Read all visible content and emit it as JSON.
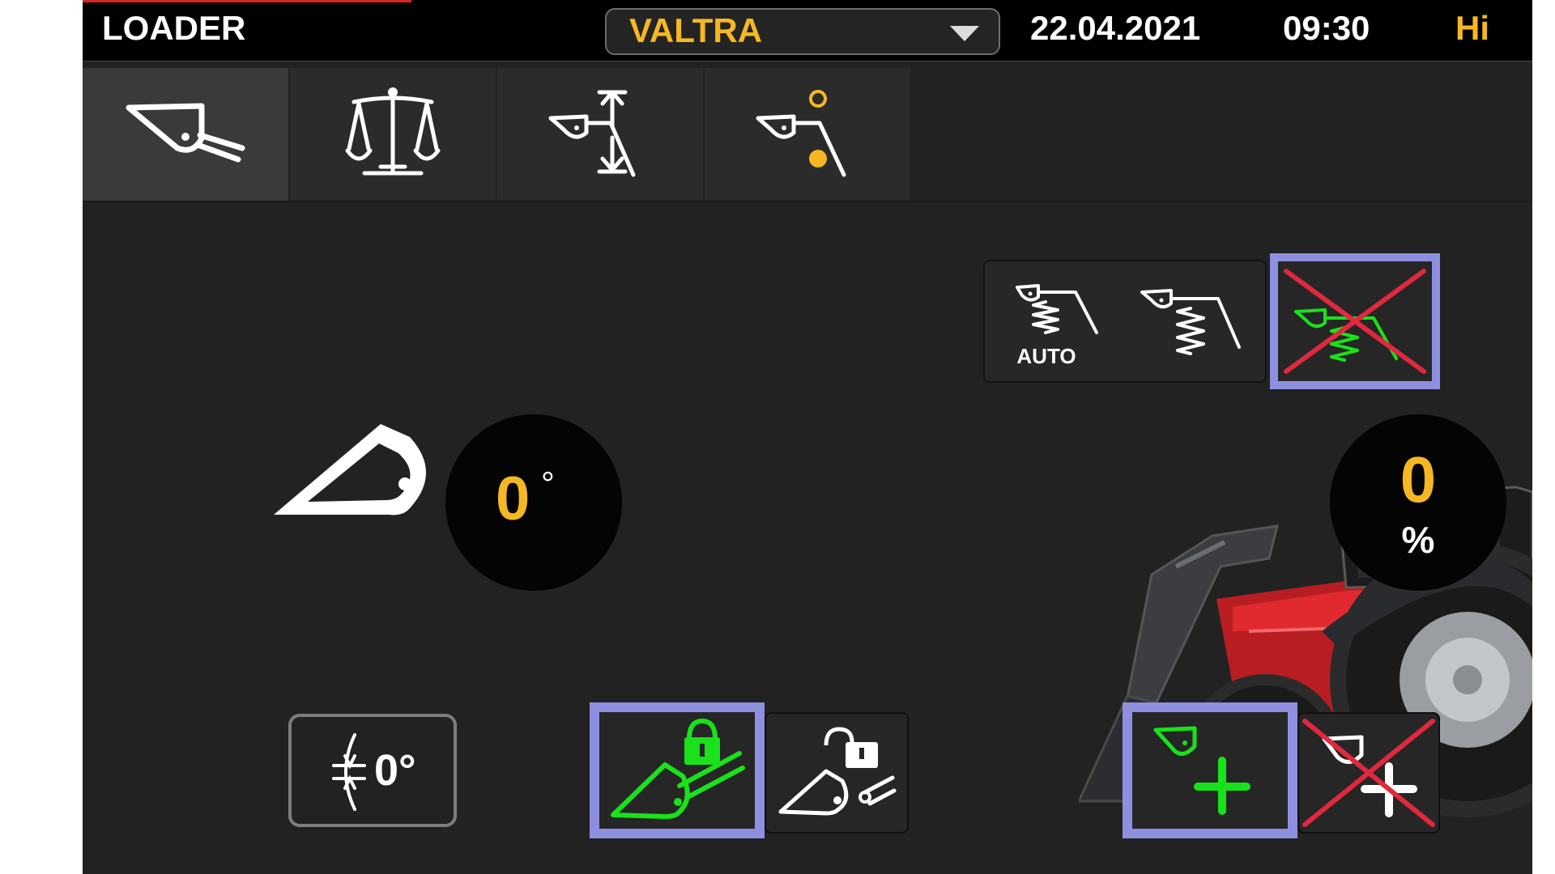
{
  "status_bar": {
    "app_title": "LOADER",
    "profile": {
      "selected": "VALTRA"
    },
    "date": "22.04.2021",
    "time": "09:30",
    "mode": "Hi"
  },
  "tabs": [
    {
      "icon": "loader-bucket-icon",
      "active": true
    },
    {
      "icon": "weighing-scale-icon",
      "active": false
    },
    {
      "icon": "lift-limits-icon",
      "active": false
    },
    {
      "icon": "memory-positions-icon",
      "active": false
    }
  ],
  "suspension": {
    "auto_label": "AUTO",
    "options": [
      "auto",
      "on",
      "off"
    ],
    "selected": "off"
  },
  "bucket_angle": {
    "value": "0",
    "unit": "°"
  },
  "load": {
    "value": "0",
    "unit": "%"
  },
  "zero_button": {
    "label": "0°"
  },
  "bucket_lock": {
    "selected": "locked"
  },
  "add_weighing": {
    "selected": "enabled"
  },
  "colors": {
    "accent_yellow": "#f5b823",
    "active_green": "#19e21a",
    "selection_frame": "#8f8fe0",
    "disabled_cross": "#e0283f",
    "status_red": "#d8261e"
  }
}
